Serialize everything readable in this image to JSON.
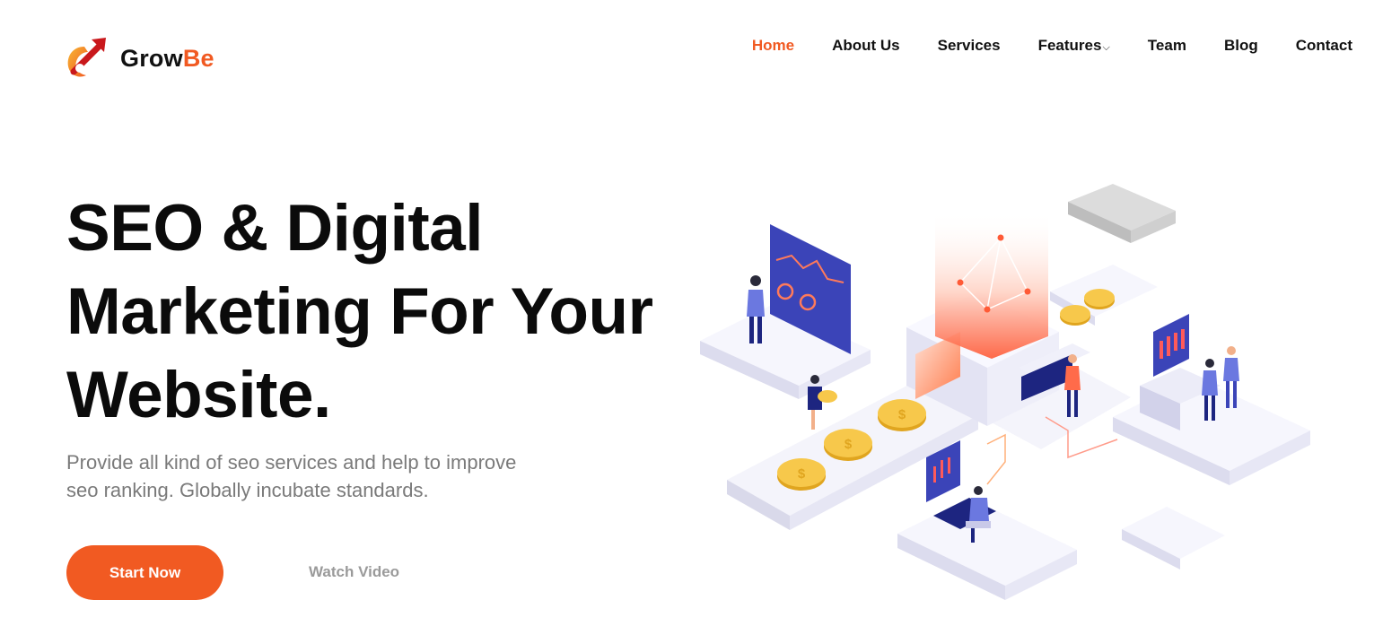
{
  "brand": {
    "name_part1": "Grow",
    "name_part2": "Be",
    "accent_color": "#f15a22"
  },
  "nav": {
    "items": [
      {
        "label": "Home",
        "active": true
      },
      {
        "label": "About Us"
      },
      {
        "label": "Services"
      },
      {
        "label": "Features",
        "has_dropdown": true
      },
      {
        "label": "Team"
      },
      {
        "label": "Blog"
      },
      {
        "label": "Contact"
      }
    ]
  },
  "hero": {
    "title_line1": "SEO & Digital",
    "title_line2": "Marketing For Your",
    "title_line3": "Website.",
    "subtitle_line1": "Provide all kind of seo services and help to improve",
    "subtitle_line2": "seo ranking. Globally incubate standards.",
    "primary_button": "Start Now",
    "secondary_button": "Watch Video"
  },
  "illustration": {
    "icon": "isometric-seo-illustration",
    "coin_symbol": "$"
  }
}
